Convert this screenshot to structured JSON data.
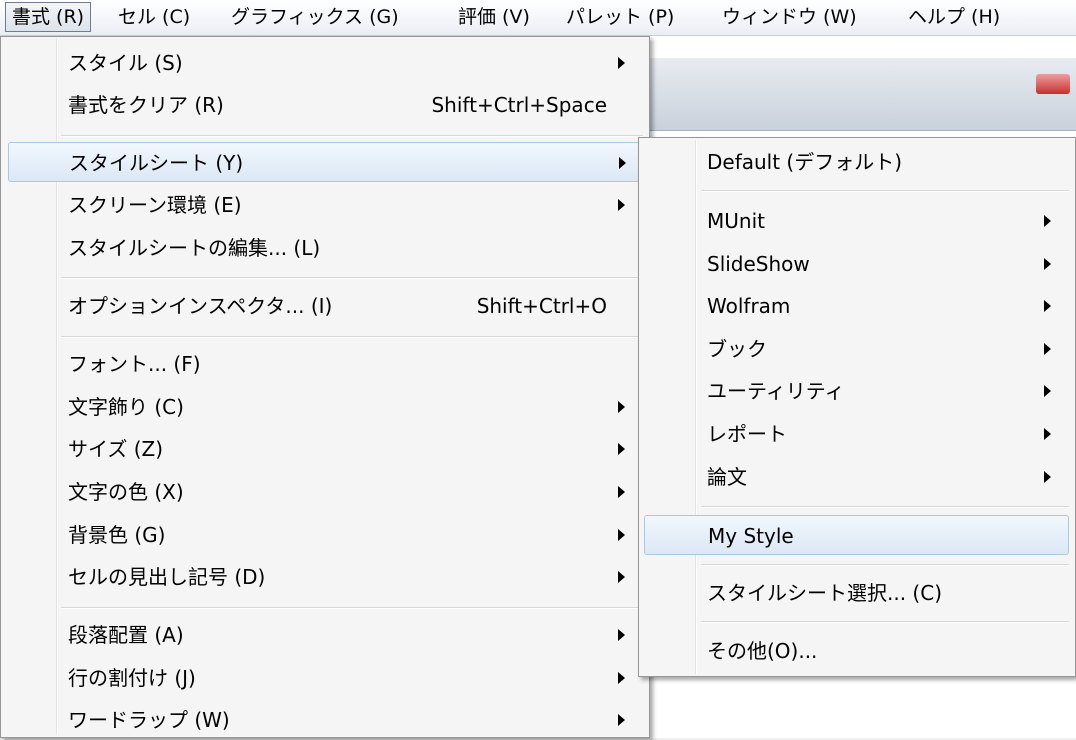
{
  "menubar": {
    "items": [
      {
        "label": "書式 (R)",
        "active": true
      },
      {
        "label": "セル (C)"
      },
      {
        "label": "グラフィックス (G)"
      },
      {
        "label": "評価 (V)"
      },
      {
        "label": "パレット (P)"
      },
      {
        "label": "ウィンドウ (W)"
      },
      {
        "label": "ヘルプ (H)"
      }
    ]
  },
  "format_menu": {
    "items": [
      {
        "label": "スタイル (S)",
        "submenu": true
      },
      {
        "label": "書式をクリア (R)",
        "shortcut": "Shift+Ctrl+Space"
      },
      {
        "label": "スタイルシート (Y)",
        "submenu": true,
        "highlighted": true
      },
      {
        "label": "スクリーン環境 (E)",
        "submenu": true
      },
      {
        "label": "スタイルシートの編集... (L)"
      },
      {
        "label": "オプションインスペクタ... (I)",
        "shortcut": "Shift+Ctrl+O"
      },
      {
        "label": "フォント... (F)"
      },
      {
        "label": "文字飾り (C)",
        "submenu": true
      },
      {
        "label": "サイズ (Z)",
        "submenu": true
      },
      {
        "label": "文字の色 (X)",
        "submenu": true
      },
      {
        "label": "背景色 (G)",
        "submenu": true
      },
      {
        "label": "セルの見出し記号 (D)",
        "submenu": true
      },
      {
        "label": "段落配置 (A)",
        "submenu": true
      },
      {
        "label": "行の割付け (J)",
        "submenu": true
      },
      {
        "label": "ワードラップ (W)",
        "submenu": true
      }
    ]
  },
  "stylesheet_menu": {
    "items": [
      {
        "label": "Default (デフォルト)"
      },
      {
        "label": "MUnit",
        "submenu": true
      },
      {
        "label": "SlideShow",
        "submenu": true
      },
      {
        "label": "Wolfram",
        "submenu": true
      },
      {
        "label": "ブック",
        "submenu": true
      },
      {
        "label": "ユーティリティ",
        "submenu": true
      },
      {
        "label": "レポート",
        "submenu": true
      },
      {
        "label": "論文",
        "submenu": true
      },
      {
        "label": "My Style",
        "highlighted": true
      },
      {
        "label": "スタイルシート選択... (C)"
      },
      {
        "label": "その他(O)..."
      }
    ]
  },
  "colors": {
    "highlight_border": "#a8c8e8",
    "highlight_fill": "#dce8f5",
    "menu_background": "#f5f5f5"
  }
}
